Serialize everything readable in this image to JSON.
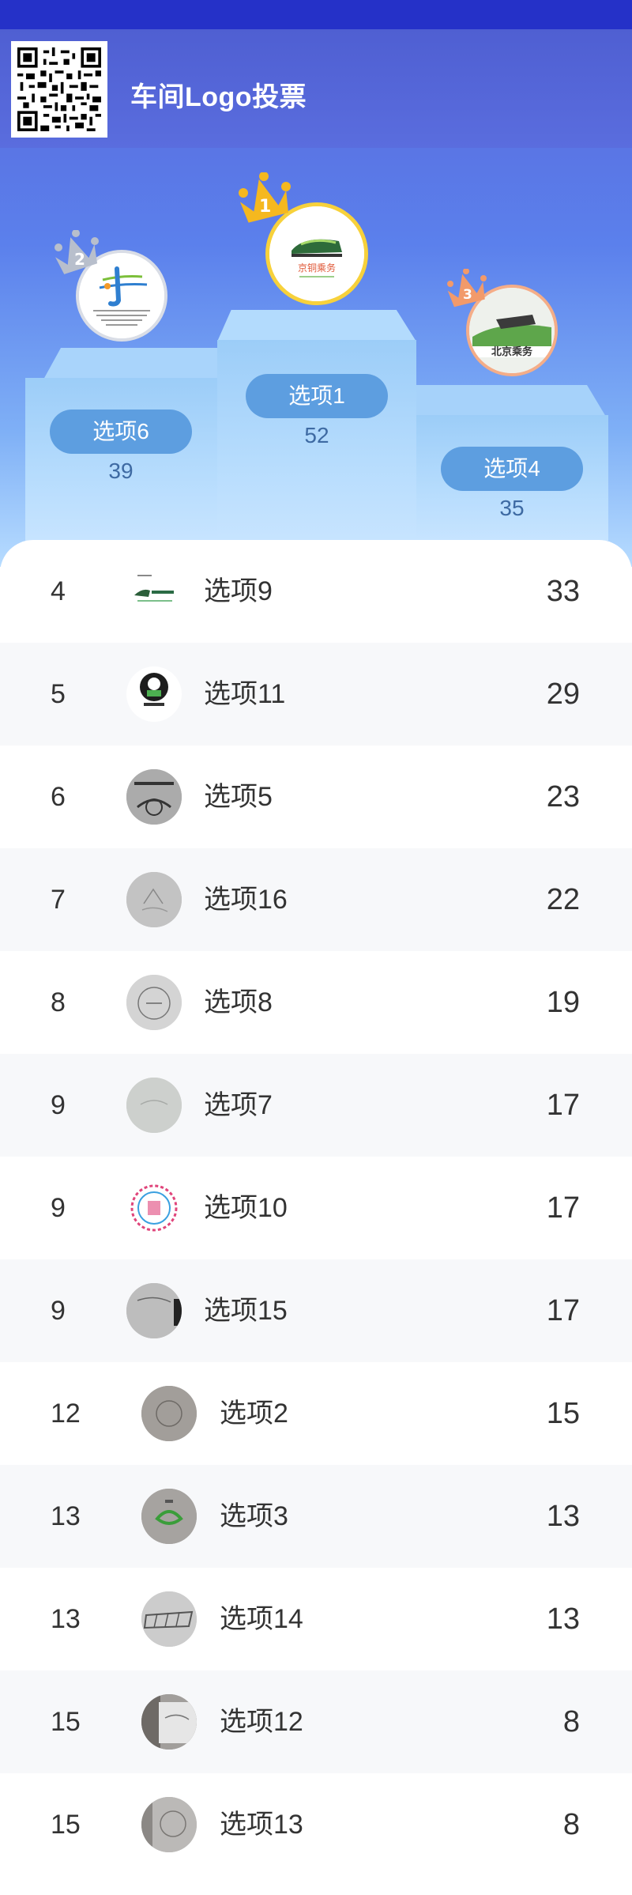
{
  "header": {
    "title": "车间Logo投票"
  },
  "podium": [
    {
      "rank": "1",
      "name": "选项1",
      "votes": "52",
      "crown_color": "#f5b81f",
      "ring_color": "#f7d13b"
    },
    {
      "rank": "2",
      "name": "选项6",
      "votes": "39",
      "crown_color": "#b8bfcc",
      "ring_color": "#d9dde6"
    },
    {
      "rank": "3",
      "name": "选项4",
      "votes": "35",
      "crown_color": "#f29a6a",
      "ring_color": "#f4ad88"
    }
  ],
  "list": [
    {
      "rank": "4",
      "name": "选项9",
      "votes": "33"
    },
    {
      "rank": "5",
      "name": "选项11",
      "votes": "29"
    },
    {
      "rank": "6",
      "name": "选项5",
      "votes": "23"
    },
    {
      "rank": "7",
      "name": "选项16",
      "votes": "22"
    },
    {
      "rank": "8",
      "name": "选项8",
      "votes": "19"
    },
    {
      "rank": "9",
      "name": "选项7",
      "votes": "17"
    },
    {
      "rank": "9",
      "name": "选项10",
      "votes": "17"
    },
    {
      "rank": "9",
      "name": "选项15",
      "votes": "17"
    },
    {
      "rank": "12",
      "name": "选项2",
      "votes": "15"
    },
    {
      "rank": "13",
      "name": "选项3",
      "votes": "13"
    },
    {
      "rank": "13",
      "name": "选项14",
      "votes": "13"
    },
    {
      "rank": "15",
      "name": "选项12",
      "votes": "8"
    },
    {
      "rank": "15",
      "name": "选项13",
      "votes": "8"
    }
  ],
  "logo_text": {
    "first": "京铜乘务",
    "third": "北京乘务"
  }
}
